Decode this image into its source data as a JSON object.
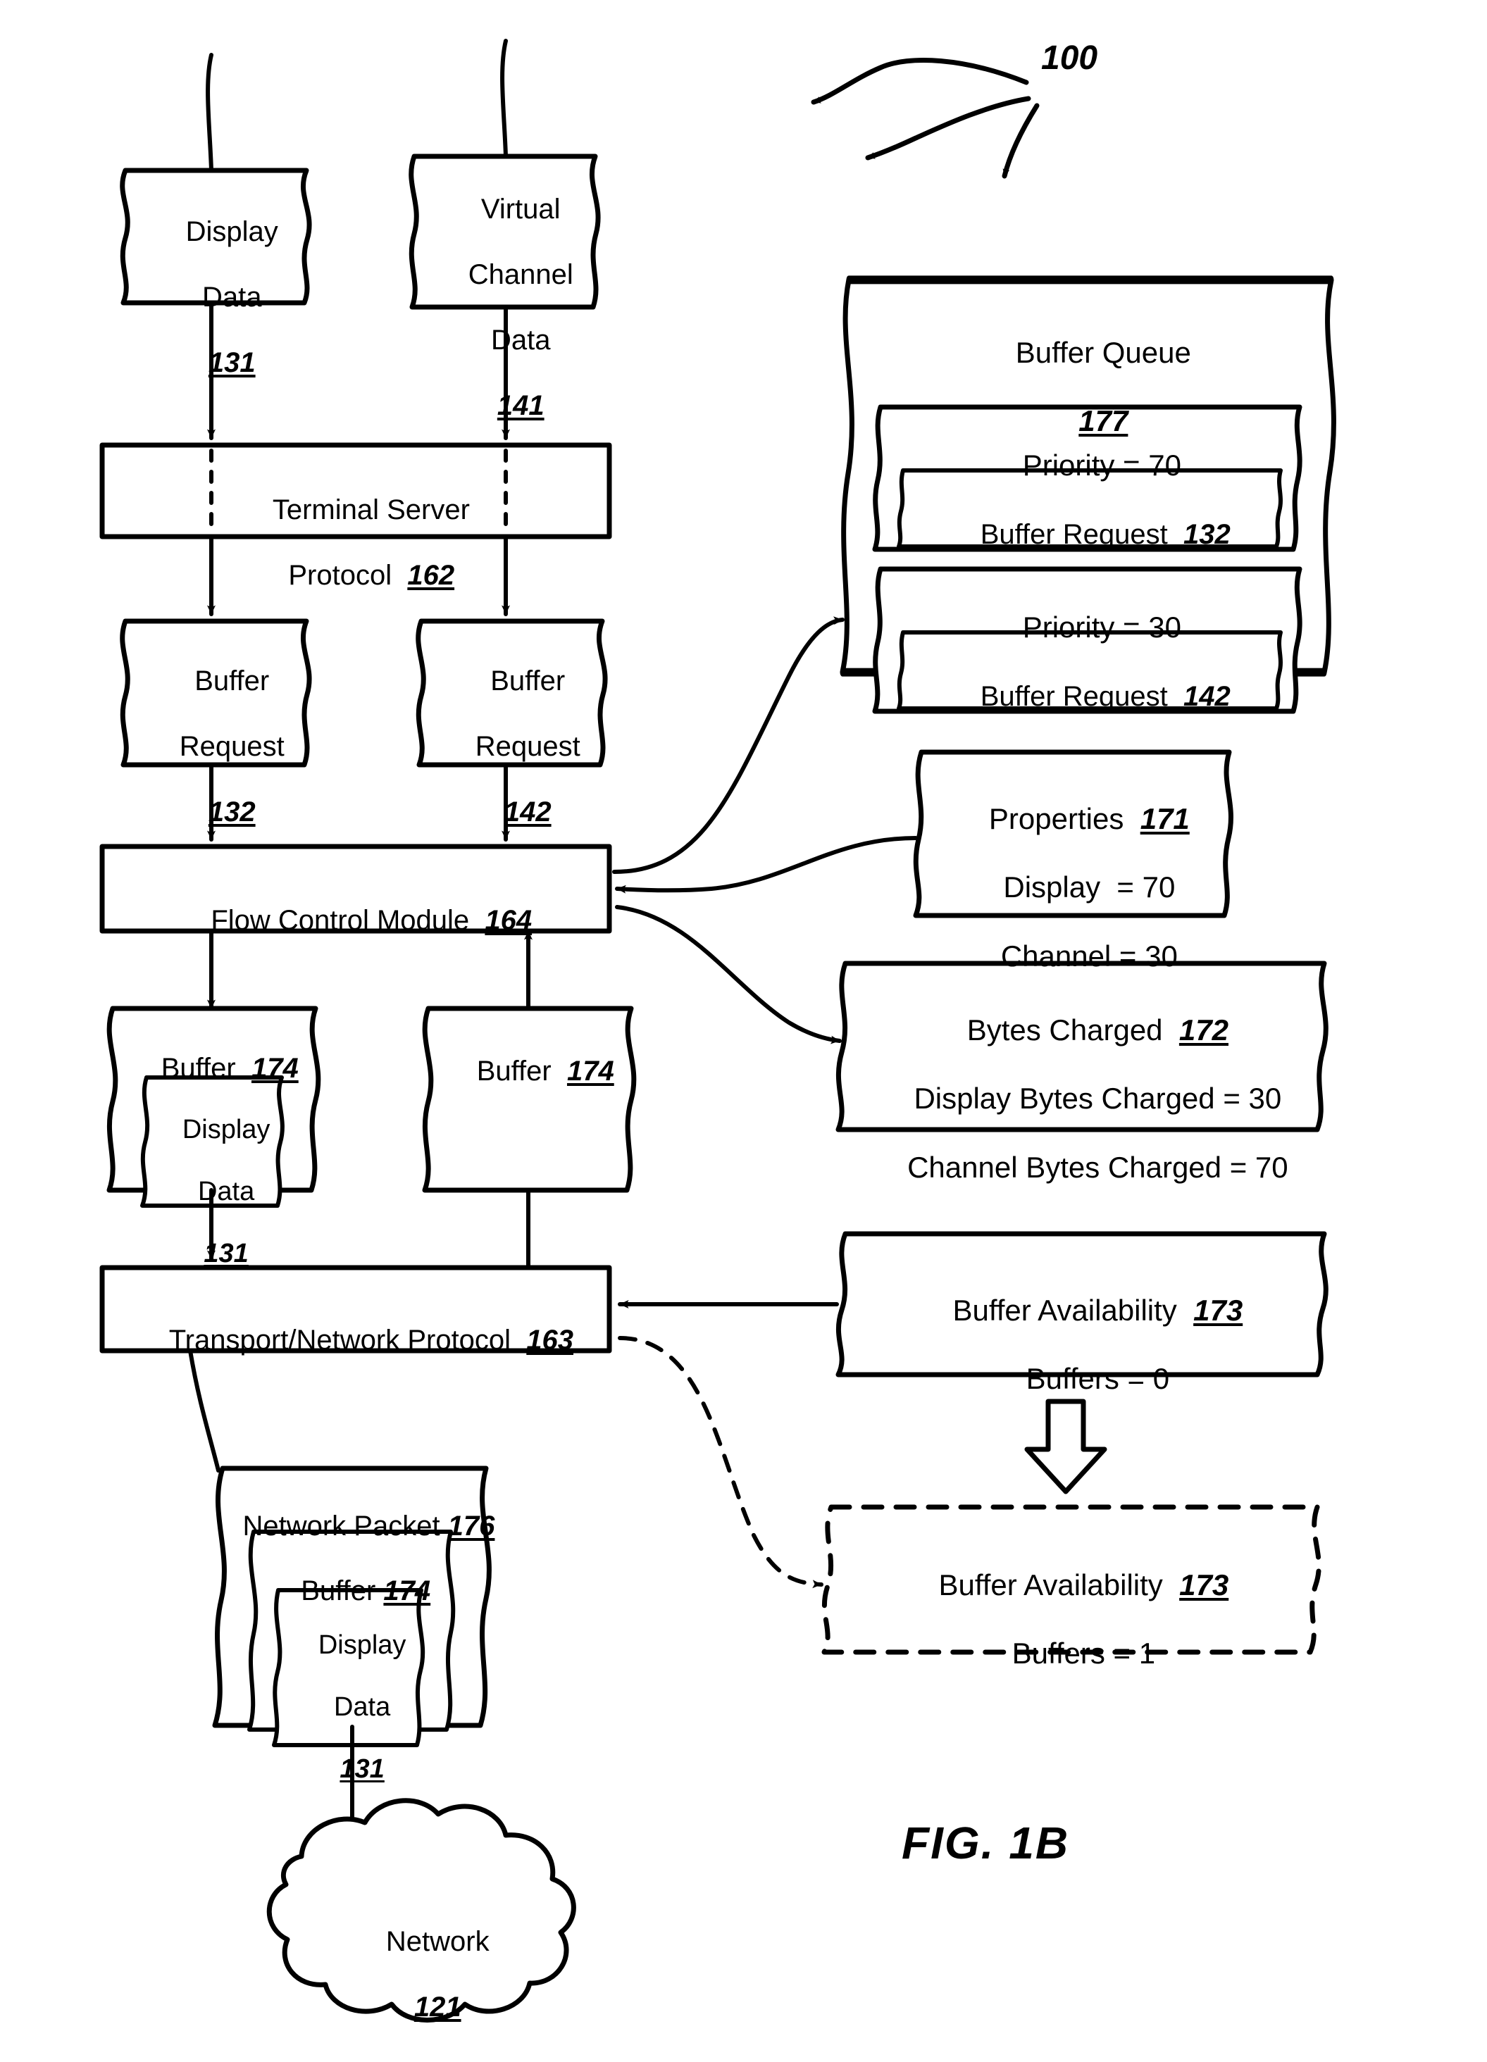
{
  "figure": {
    "label": "FIG.  1B",
    "callout_number": "100"
  },
  "nodes": {
    "display_data_src": {
      "lines": [
        "Display",
        "Data"
      ],
      "ref": "131"
    },
    "virtual_channel_data_src": {
      "lines": [
        "Virtual",
        "Channel",
        "Data"
      ],
      "ref": "141"
    },
    "terminal_server_protocol": {
      "lines": [
        "Terminal Server",
        "Protocol  "
      ],
      "ref": "162"
    },
    "buffer_request_left": {
      "lines": [
        "Buffer",
        "Request"
      ],
      "ref": "132"
    },
    "buffer_request_right": {
      "lines": [
        "Buffer",
        "Request"
      ],
      "ref": "142"
    },
    "flow_control_module": {
      "label": "Flow Control Module  ",
      "ref": "164"
    },
    "buffer_left": {
      "label": "Buffer  ",
      "ref": "174"
    },
    "buffer_left_inner": {
      "lines": [
        "Display",
        "Data"
      ],
      "ref": "131"
    },
    "buffer_right": {
      "label": "Buffer  ",
      "ref": "174"
    },
    "transport_network_protocol": {
      "label": "Transport/Network Protocol  ",
      "ref": "163"
    },
    "network_packet": {
      "label": "Network Packet ",
      "ref": "176"
    },
    "network_packet_buffer": {
      "label": "Buffer ",
      "ref": "174"
    },
    "network_packet_display_data": {
      "lines": [
        "Display",
        "Data"
      ],
      "ref": "131"
    },
    "network_cloud": {
      "label": "Network",
      "ref": "121"
    }
  },
  "buffer_queue": {
    "title": "Buffer Queue",
    "ref": "177",
    "entries": [
      {
        "priority_label": "Priority = 70",
        "request_label": "Buffer Request  ",
        "request_ref": "132"
      },
      {
        "priority_label": "Priority = 30",
        "request_label": "Buffer Request  ",
        "request_ref": "142"
      }
    ]
  },
  "properties": {
    "title": "Properties  ",
    "ref": "171",
    "rows": [
      "Display  = 70",
      "Channel = 30"
    ]
  },
  "bytes_charged": {
    "title": "Bytes Charged  ",
    "ref": "172",
    "rows": [
      "Display Bytes Charged = 30",
      "Channel Bytes Charged = 70"
    ]
  },
  "buffer_availability_before": {
    "title": "Buffer Availability  ",
    "ref": "173",
    "rows": [
      "Buffers = 0"
    ]
  },
  "buffer_availability_after": {
    "title": "Buffer Availability  ",
    "ref": "173",
    "rows": [
      "Buffers = 1"
    ]
  },
  "colors": {
    "stroke": "#000000",
    "background": "#ffffff"
  }
}
